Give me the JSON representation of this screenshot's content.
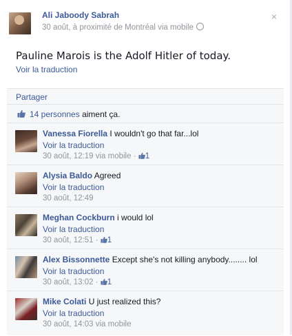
{
  "post": {
    "author": "Ali Jaboody Sabrah",
    "meta": "30 août, à proximité de Montréal via mobile",
    "text": "Pauline Marois is the Adolf Hitler of today.",
    "translate": "Voir la traduction",
    "close_icon": "×"
  },
  "feedback": {
    "share_label": "Partager",
    "likes_link": "14 personnes",
    "likes_suffix": " aiment ça."
  },
  "comments": [
    {
      "name": "Vanessa Fiorella",
      "text": " I wouldn't go that far...lol",
      "translate": "Voir la traduction",
      "time": "30 août, 12:19 via mobile · ",
      "likes": "1"
    },
    {
      "name": "Alysia Baldo",
      "text": " Agreed",
      "translate": "Voir la traduction",
      "time": "30 août, 12:49",
      "likes": ""
    },
    {
      "name": "Meghan Cockburn",
      "text": " i would lol",
      "translate": "Voir la traduction",
      "time": "30 août, 12:51 · ",
      "likes": "1"
    },
    {
      "name": "Alex Bissonnette",
      "text": " Except she's not killing anybody........ lol",
      "translate": "Voir la traduction",
      "time": "30 août, 13:02 · ",
      "likes": "1"
    },
    {
      "name": "Mike Colati",
      "text": " U just realized this?",
      "translate": "Voir la traduction",
      "time": "30 août, 14:03 via mobile",
      "likes": ""
    }
  ],
  "colors": {
    "link": "#3b5998",
    "meta": "#90949c",
    "panel": "#f6f7f8"
  },
  "icons": {
    "like": "thumbs-up-icon",
    "globe": "globe-icon",
    "close": "close-icon"
  }
}
